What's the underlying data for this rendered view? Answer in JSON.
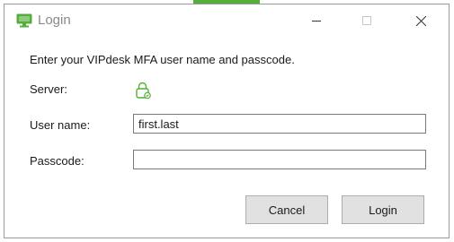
{
  "window": {
    "title": "Login",
    "app_icon": "monitor-icon",
    "controls": [
      "minimize-icon",
      "maximize-icon",
      "close-icon"
    ]
  },
  "form": {
    "instruction": "Enter your VIPdesk MFA user name and passcode.",
    "server_label": "Server:",
    "server_icon": "lock-icon",
    "username_label": "User name:",
    "username_value": "first.last",
    "passcode_label": "Passcode:",
    "passcode_value": ""
  },
  "buttons": {
    "cancel_label": "Cancel",
    "login_label": "Login"
  },
  "colors": {
    "brand_green": "#56ae3a",
    "button_bg": "#e1e1e1",
    "title_text": "#8a8a8a"
  }
}
